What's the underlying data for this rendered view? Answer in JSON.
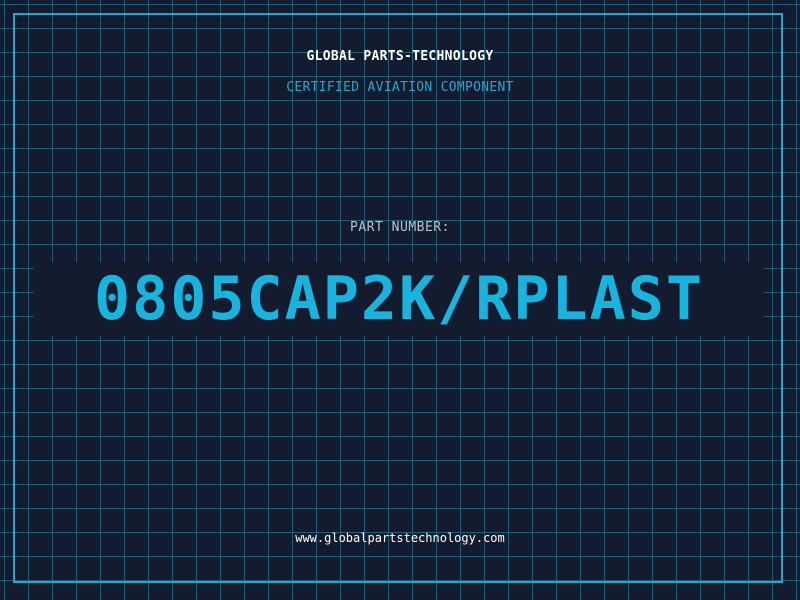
{
  "header": {
    "company": "GLOBAL PARTS-TECHNOLOGY",
    "subtitle": "CERTIFIED AVIATION COMPONENT"
  },
  "part": {
    "label": "PART NUMBER:",
    "number": "0805CAP2K/RPLAST"
  },
  "footer": {
    "url": "www.globalpartstechnology.com"
  },
  "colors": {
    "background": "#131c2e",
    "grid": "#1e5c78",
    "accent": "#26a6cf",
    "part_number": "#18b4e0",
    "text": "#ffffff",
    "label": "#b7c3cf"
  }
}
